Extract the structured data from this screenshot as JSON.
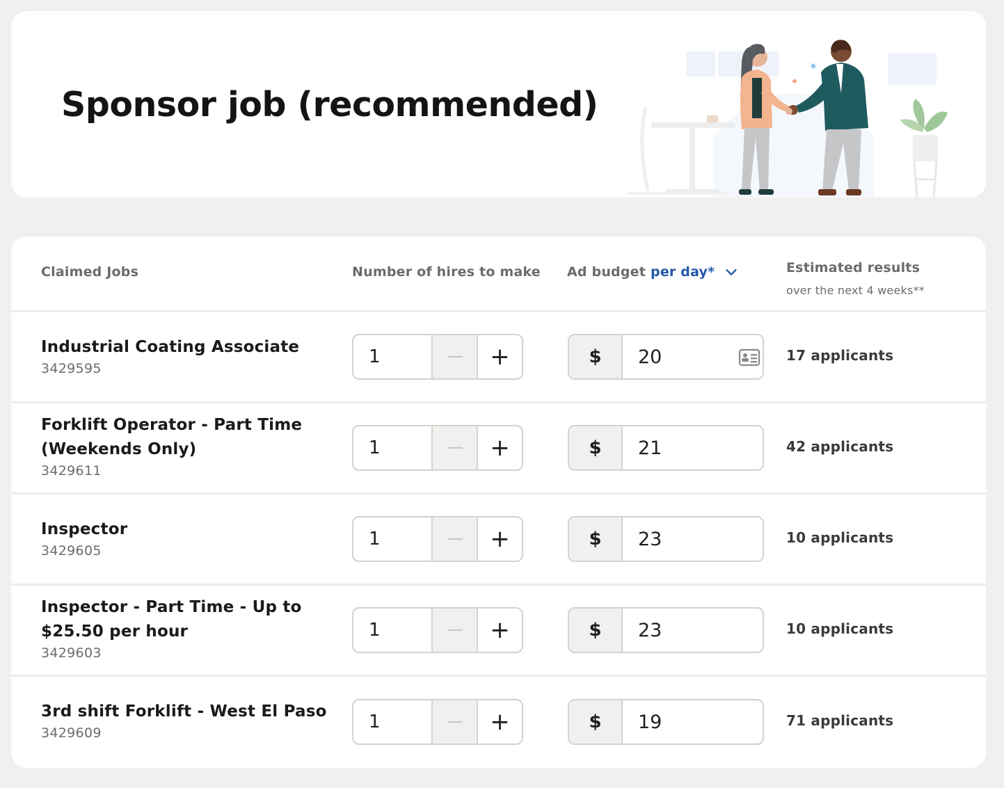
{
  "page": {
    "title": "Sponsor job (recommended)"
  },
  "table": {
    "headers": {
      "jobs": "Claimed Jobs",
      "hires": "Number of hires to make",
      "budget": "Ad budget",
      "budget_period": "per day*",
      "results": "Estimated results",
      "results_sub": "over the next 4 weeks**"
    },
    "rows": [
      {
        "title": "Industrial Coating Associate",
        "id": "3429595",
        "hires": "1",
        "currency": "$",
        "budget": "20",
        "results": "17 applicants"
      },
      {
        "title": "Forklift Operator - Part Time (Weekends Only)",
        "id": "3429611",
        "hires": "1",
        "currency": "$",
        "budget": "21",
        "results": "42 applicants"
      },
      {
        "title": "Inspector",
        "id": "3429605",
        "hires": "1",
        "currency": "$",
        "budget": "23",
        "results": "10 applicants"
      },
      {
        "title": "Inspector - Part Time - Up to $25.50 per hour",
        "id": "3429603",
        "hires": "1",
        "currency": "$",
        "budget": "23",
        "results": "10 applicants"
      },
      {
        "title": "3rd shift Forklift - West El Paso",
        "id": "3429609",
        "hires": "1",
        "currency": "$",
        "budget": "19",
        "results": "71 applicants"
      }
    ],
    "stepper_plus_symbol": "+"
  },
  "colors": {
    "accent": "#2557a7",
    "background": "#f1f0ee",
    "card": "#ffffff"
  },
  "icons": {
    "sort_dropdown": "chevron-down-icon",
    "autofill": "contact-card-icon"
  }
}
